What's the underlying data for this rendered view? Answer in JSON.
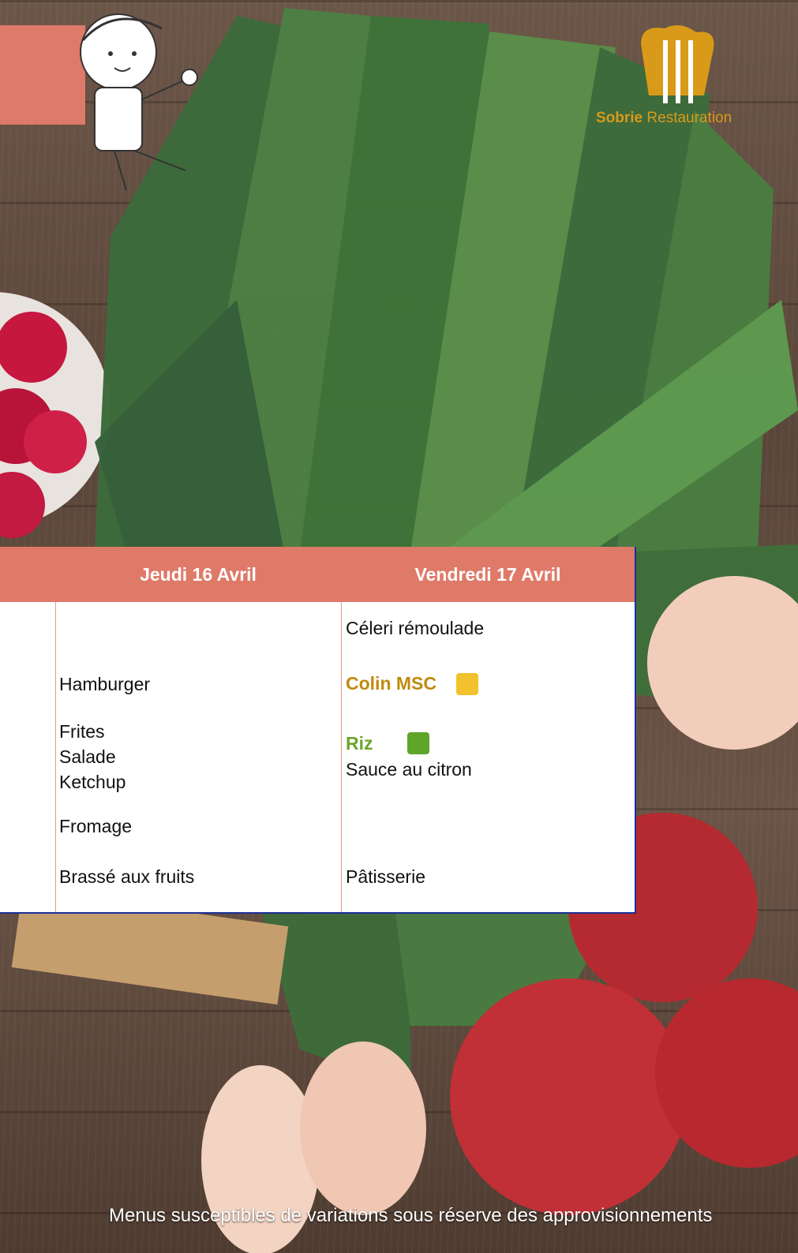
{
  "brand": {
    "name_bold": "Sobrie",
    "name_rest": " Restauration",
    "accent": "#d99a1a"
  },
  "colors": {
    "header_band": "#df7a69",
    "table_border": "#1c2f9a",
    "msc": "#c08a10",
    "bio": "#6aa62a"
  },
  "days": [
    {
      "title": "Jeudi 16 Avril",
      "items": [
        "Hamburger",
        "Frites",
        "Salade",
        "Ketchup",
        "Fromage",
        "Brassé aux fruits"
      ]
    },
    {
      "title": "Vendredi 17 Avril",
      "items": [
        "Céleri rémoulade",
        "Colin MSC",
        "Riz",
        "Sauce au citron",
        "Pâtisserie"
      ]
    }
  ],
  "icons": {
    "msc": "msc-label-icon",
    "bio": "bio-label-icon"
  },
  "footer": "Menus susceptibles de variations sous réserve des approvisionnements"
}
